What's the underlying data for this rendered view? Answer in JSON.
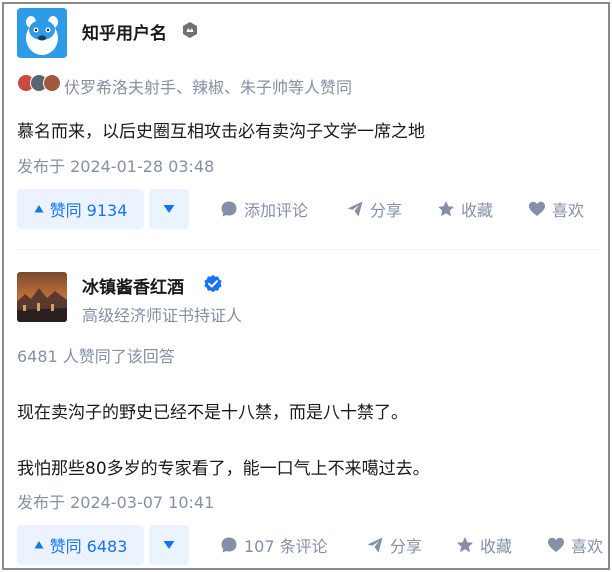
{
  "post1": {
    "author": "知乎用户名",
    "likers": "伏罗希洛夫射手、辣椒、朱子帅等人赞同",
    "content": "慕名而来，以后史圈互相攻击必有卖沟子文学一席之地",
    "date": "发布于 2024-01-28 03:48",
    "vote_label": "赞同 9134",
    "actions": {
      "comment": "添加评论",
      "share": "分享",
      "favorite": "收藏",
      "like": "喜欢"
    }
  },
  "post2": {
    "author": "冰镇酱香红酒",
    "headline": "高级经济师证书持证人",
    "agree_count": "6481 人赞同了该回答",
    "content_lines": [
      "现在卖沟子的野史已经不是十八禁，而是八十禁了。",
      "我怕那些80多岁的专家看了，能一口气上不来噶过去。"
    ],
    "date": "发布于 2024-03-07 10:41",
    "vote_label": "赞同 6483",
    "actions": {
      "comment": "107 条评论",
      "share": "分享",
      "favorite": "收藏",
      "like": "喜欢"
    }
  },
  "colors": {
    "accent": "#1772f6",
    "accent_bg": "#eaf3ff",
    "muted": "#8590a6",
    "verified": "#1772f6"
  }
}
